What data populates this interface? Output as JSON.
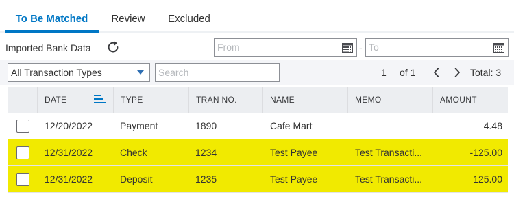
{
  "tabs": [
    {
      "label": "To Be Matched",
      "active": true
    },
    {
      "label": "Review",
      "active": false
    },
    {
      "label": "Excluded",
      "active": false
    }
  ],
  "toolbar": {
    "bank_label": "Imported Bank Data",
    "refresh_icon": "refresh-icon",
    "from_placeholder": "From",
    "to_placeholder": "To",
    "date_separator": "-"
  },
  "filter": {
    "type_selected": "All Transaction Types",
    "search_placeholder": "Search"
  },
  "pager": {
    "current": "1",
    "of": "of 1",
    "prev_icon": "chevron-left-icon",
    "next_icon": "chevron-right-icon",
    "total": "Total: 3"
  },
  "table": {
    "headers": {
      "date": "DATE",
      "type": "TYPE",
      "tran_no": "TRAN NO.",
      "name": "NAME",
      "memo": "MEMO",
      "amount": "AMOUNT"
    },
    "rows": [
      {
        "date": "12/20/2022",
        "type": "Payment",
        "tran_no": "1890",
        "name": "Cafe Mart",
        "memo": "",
        "amount": "4.48",
        "highlighted": false
      },
      {
        "date": "12/31/2022",
        "type": "Check",
        "tran_no": "1234",
        "name": "Test Payee",
        "memo": "Test Transacti...",
        "amount": "-125.00",
        "highlighted": true
      },
      {
        "date": "12/31/2022",
        "type": "Deposit",
        "tran_no": "1235",
        "name": "Test Payee",
        "memo": "Test Transacti...",
        "amount": "125.00",
        "highlighted": true
      }
    ]
  },
  "colors": {
    "accent": "#0077c5",
    "highlight": "#f1ea00",
    "header_bg": "#eceef1"
  }
}
